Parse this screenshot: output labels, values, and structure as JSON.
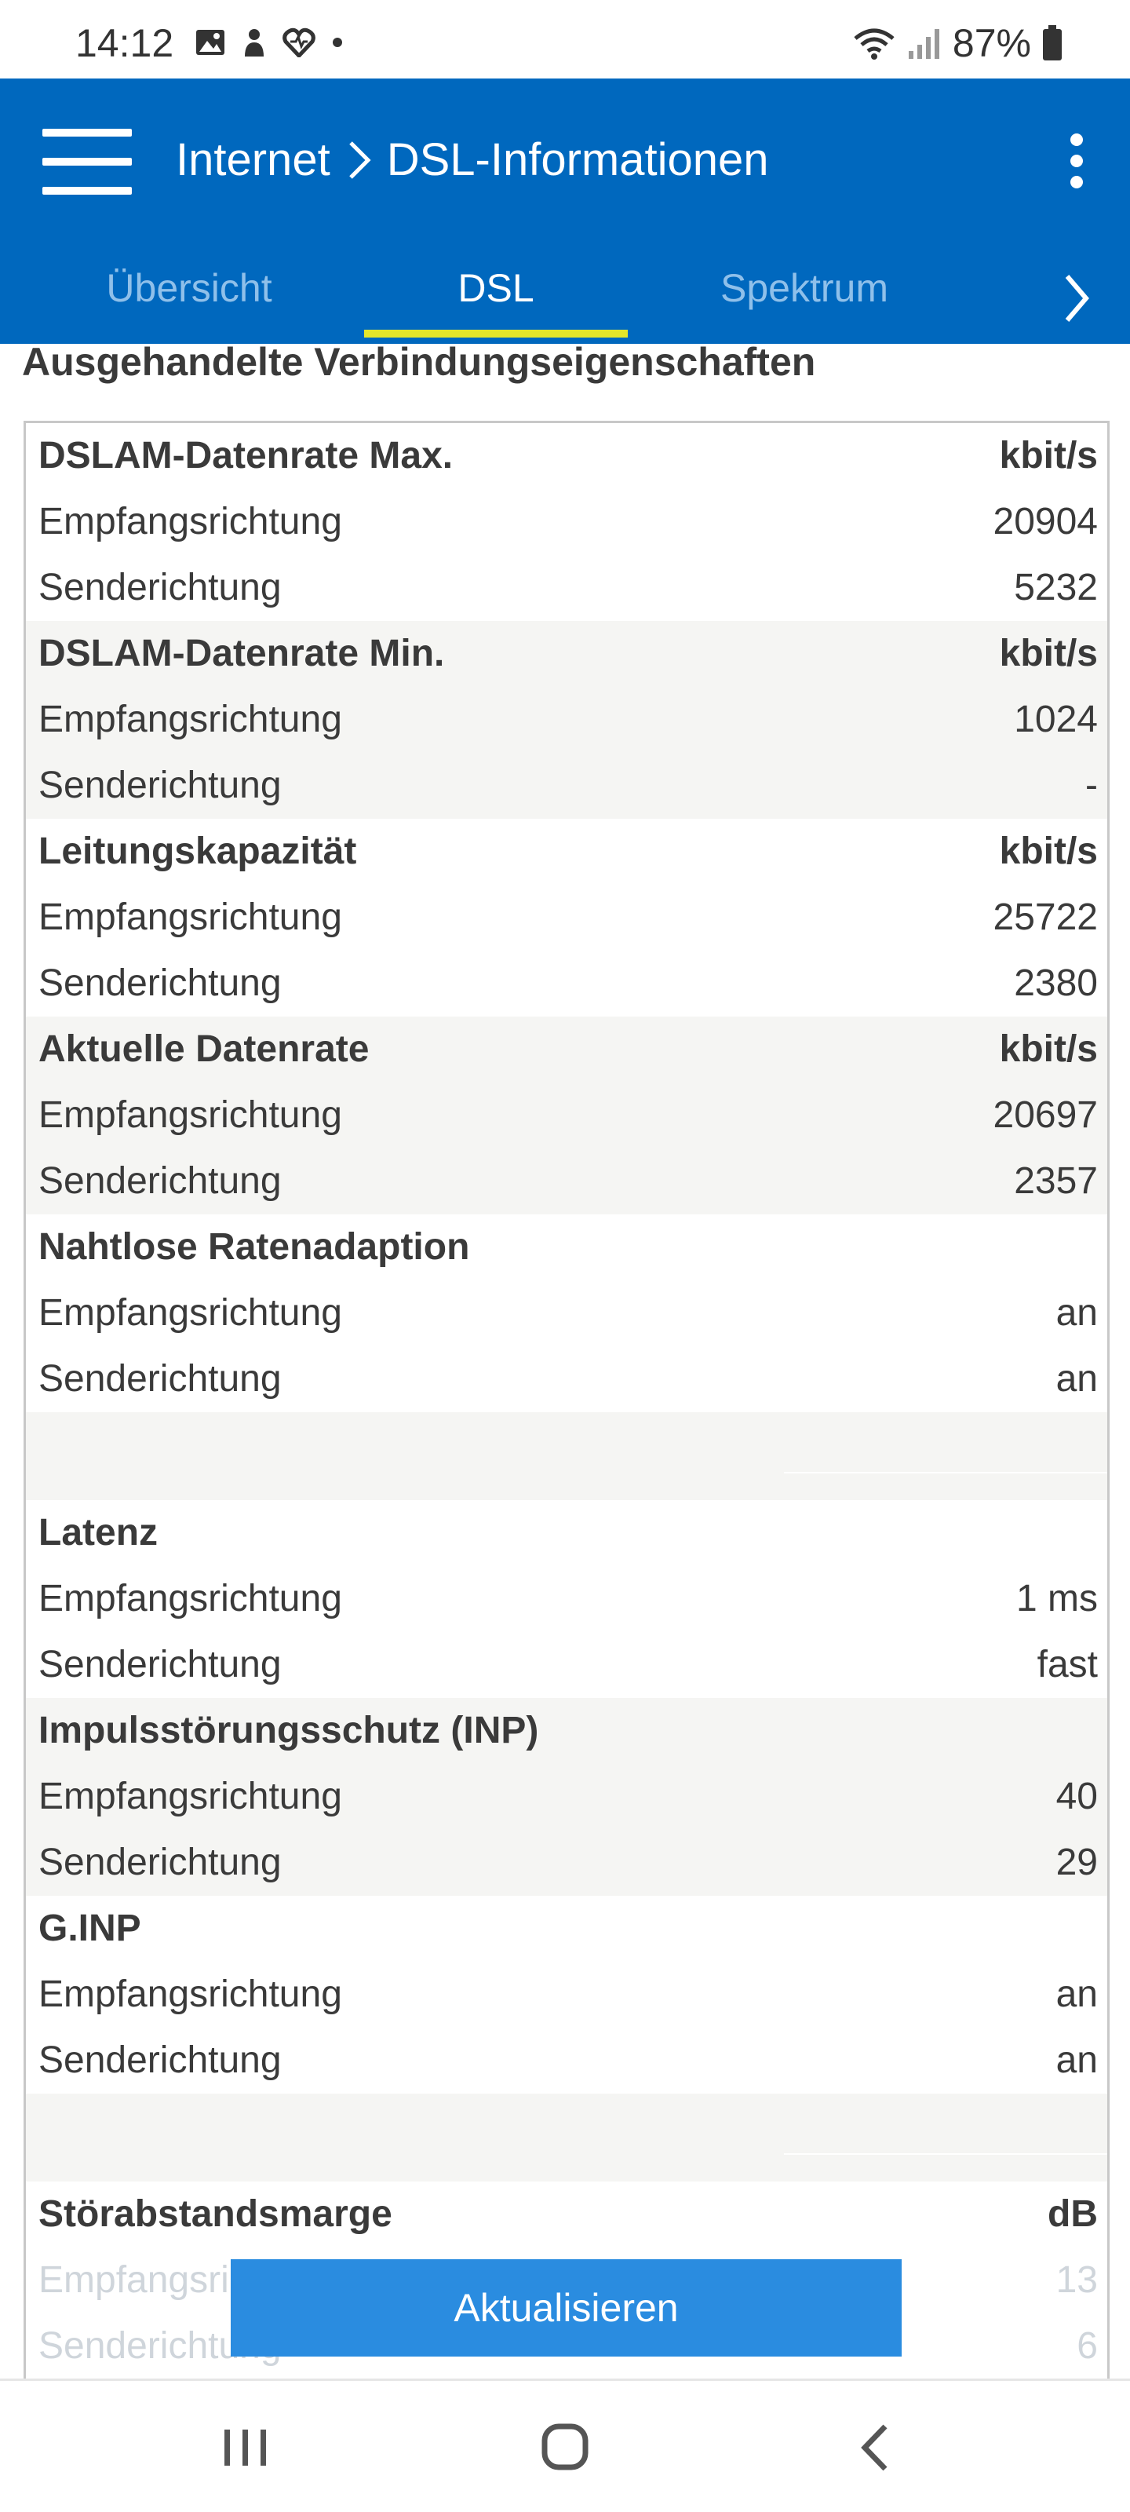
{
  "status_bar": {
    "time": "14:12",
    "battery": "87%",
    "icons": [
      "gallery-icon",
      "app-icon",
      "heart-icon",
      "dot-icon",
      "wifi-icon",
      "signal-icon",
      "battery-icon"
    ]
  },
  "header": {
    "breadcrumb": [
      "Internet",
      "DSL-Informationen"
    ],
    "tabs": [
      {
        "label": "Übersicht",
        "active": false
      },
      {
        "label": "DSL",
        "active": true
      },
      {
        "label": "Spektrum",
        "active": false
      }
    ],
    "accent": "#0068be",
    "underline_color": "#e5e62a"
  },
  "section_title": "Ausgehandelte Verbindungseigenschaften",
  "groups": [
    {
      "title": "DSLAM-Datenrate Max.",
      "unit": "kbit/s",
      "rx_label": "Empfangsrichtung",
      "rx": "20904",
      "tx_label": "Senderichtung",
      "tx": "5232"
    },
    {
      "title": "DSLAM-Datenrate Min.",
      "unit": "kbit/s",
      "rx_label": "Empfangsrichtung",
      "rx": "1024",
      "tx_label": "Senderichtung",
      "tx": "-"
    },
    {
      "title": "Leitungskapazität",
      "unit": "kbit/s",
      "rx_label": "Empfangsrichtung",
      "rx": "25722",
      "tx_label": "Senderichtung",
      "tx": "2380"
    },
    {
      "title": "Aktuelle Datenrate",
      "unit": "kbit/s",
      "rx_label": "Empfangsrichtung",
      "rx": "20697",
      "tx_label": "Senderichtung",
      "tx": "2357"
    },
    {
      "title": "Nahtlose Ratenadaption",
      "unit": "",
      "rx_label": "Empfangsrichtung",
      "rx": "an",
      "tx_label": "Senderichtung",
      "tx": "an"
    },
    {
      "title": "Latenz",
      "unit": "",
      "rx_label": "Empfangsrichtung",
      "rx": "1 ms",
      "tx_label": "Senderichtung",
      "tx": "fast"
    },
    {
      "title": "Impulsstörungsschutz (INP)",
      "unit": "",
      "rx_label": "Empfangsrichtung",
      "rx": "40",
      "tx_label": "Senderichtung",
      "tx": "29"
    },
    {
      "title": "G.INP",
      "unit": "",
      "rx_label": "Empfangsrichtung",
      "rx": "an",
      "tx_label": "Senderichtung",
      "tx": "an"
    },
    {
      "title": "Störabstandsmarge",
      "unit": "dB",
      "rx_label": "Empfangsri",
      "rx": "13",
      "tx_label": "Senderichtung",
      "tx": "6"
    }
  ],
  "refresh_button": "Aktualisieren"
}
